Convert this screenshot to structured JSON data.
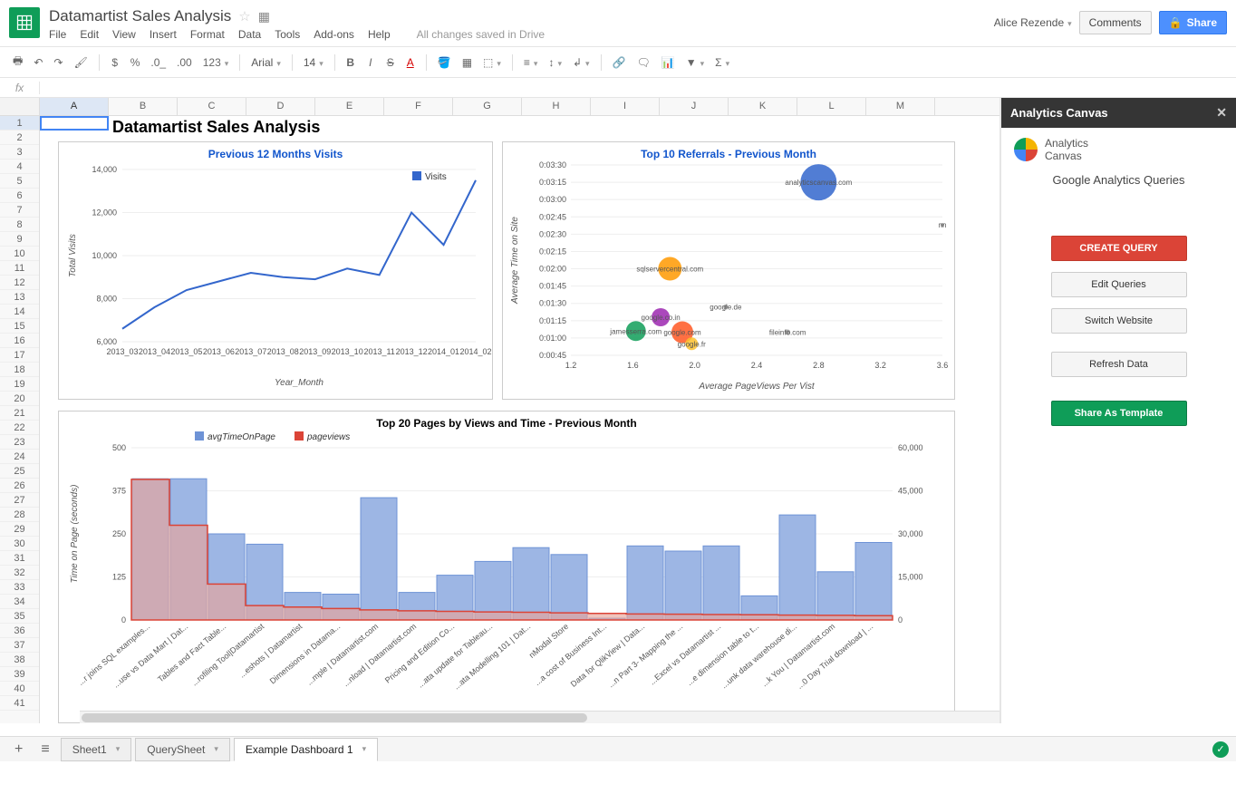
{
  "doc": {
    "title": "Datamartist Sales Analysis"
  },
  "user": {
    "name": "Alice Rezende"
  },
  "header": {
    "comments": "Comments",
    "share": "Share",
    "status": "All changes saved in Drive"
  },
  "menus": [
    "File",
    "Edit",
    "View",
    "Insert",
    "Format",
    "Data",
    "Tools",
    "Add-ons",
    "Help"
  ],
  "toolbar": {
    "font": "Arial",
    "size": "14",
    "numfmt": "123"
  },
  "formula": {
    "label": "fx",
    "value": ""
  },
  "columns": [
    "A",
    "B",
    "C",
    "D",
    "E",
    "F",
    "G",
    "H",
    "I",
    "J",
    "K",
    "L",
    "M"
  ],
  "dashboard": {
    "title": "Datamartist Sales Analysis"
  },
  "sidebar": {
    "title": "Analytics Canvas",
    "brand": "Analytics\nCanvas",
    "heading": "Google Analytics Queries",
    "create": "CREATE QUERY",
    "edit": "Edit Queries",
    "switch": "Switch Website",
    "refresh": "Refresh Data",
    "share": "Share As Template"
  },
  "tabs": {
    "sheet1": "Sheet1",
    "query": "QuerySheet",
    "dash": "Example Dashboard 1"
  },
  "chart_data": [
    {
      "id": "visits_line",
      "type": "line",
      "title": "Previous 12 Months Visits",
      "xlabel": "Year_Month",
      "ylabel": "Total Visits",
      "series": [
        {
          "name": "Visits",
          "color": "#3366cc"
        }
      ],
      "categories": [
        "2013_03",
        "2013_04",
        "2013_05",
        "2013_06",
        "2013_07",
        "2013_08",
        "2013_09",
        "2013_10",
        "2013_11",
        "2013_12",
        "2014_01",
        "2014_02"
      ],
      "values": [
        6600,
        7600,
        8400,
        8800,
        9200,
        9000,
        8900,
        9400,
        9100,
        12000,
        10500,
        13500
      ],
      "ylim": [
        6000,
        14000
      ],
      "yticks": [
        6000,
        8000,
        10000,
        12000,
        14000
      ]
    },
    {
      "id": "referrals_bubble",
      "type": "scatter",
      "title": "Top 10 Referrals - Previous Month",
      "xlabel": "Average PageViews Per Vist",
      "ylabel": "Average Time on Site",
      "xlim": [
        1.2,
        3.6
      ],
      "xticks": [
        1.2,
        1.6,
        2.0,
        2.4,
        2.8,
        3.2,
        3.6
      ],
      "yticks": [
        "0:00:45",
        "0:01:00",
        "0:01:15",
        "0:01:30",
        "0:01:45",
        "0:02:00",
        "0:02:15",
        "0:02:30",
        "0:02:45",
        "0:03:00",
        "0:03:15",
        "0:03:30"
      ],
      "points": [
        {
          "label": "analyticscanvas.com",
          "x": 2.8,
          "y": "0:03:15",
          "size": 40,
          "color": "#3366cc"
        },
        {
          "label": "sqlservercentral.com",
          "x": 1.84,
          "y": "0:02:00",
          "size": 26,
          "color": "#ff9900"
        },
        {
          "label": "google.de",
          "x": 2.2,
          "y": "0:01:27",
          "size": 5,
          "color": "#999"
        },
        {
          "label": "google.co.in",
          "x": 1.78,
          "y": "0:01:18",
          "size": 20,
          "color": "#9c27b0"
        },
        {
          "label": "jamesserra.com",
          "x": 1.62,
          "y": "0:01:06",
          "size": 22,
          "color": "#0f9d58"
        },
        {
          "label": "google.com",
          "x": 1.92,
          "y": "0:01:05",
          "size": 24,
          "color": "#ff5722"
        },
        {
          "label": "fileinfo.com",
          "x": 2.6,
          "y": "0:01:05",
          "size": 6,
          "color": "#999"
        },
        {
          "label": "google.fr",
          "x": 1.98,
          "y": "0:00:55",
          "size": 14,
          "color": "#fbc02d"
        },
        {
          "label": "nn",
          "x": 3.6,
          "y": "0:02:38",
          "size": 4,
          "color": "#999"
        }
      ]
    },
    {
      "id": "pages_combo",
      "type": "bar",
      "title": "Top 20 Pages by Views and Time - Previous Month",
      "y_left_label": "Time on Page (seconds)",
      "y_left_lim": [
        0,
        500
      ],
      "y_left_ticks": [
        0,
        125,
        250,
        375,
        500
      ],
      "y_right_lim": [
        0,
        60000
      ],
      "y_right_ticks": [
        0,
        15000,
        30000,
        45000,
        60000
      ],
      "series": [
        {
          "name": "avgTimeOnPage",
          "color": "#6e93d6",
          "axis": "left"
        },
        {
          "name": "pageviews",
          "color": "#db4437",
          "axis": "right"
        }
      ],
      "categories": [
        "...r joins SQL examples...",
        "...use vs Data Mart | Dat...",
        "Tables and Fact Table...",
        "...rofiling Tool|Datamartist",
        "...eshots | Datamartist",
        "Dimensions in Datama...",
        "...mple | Datamartist.com",
        "...nload | Datamartist.com",
        "Pricing and Edition Co...",
        "...ata update for Tableau...",
        "...ata Modelling 101 | Dat...",
        "nModal Store",
        "...a cost of Business Int...",
        "Data for QlikView | Data...",
        "...n Part 3- Mapping the ...",
        "...Excel vs Datamartist ...",
        "...e dimension table to t...",
        "...unk data warehouse di...",
        "...k You | Datamartist.com",
        "...0 Day Trial download | ..."
      ],
      "avgTimeOnPage": [
        410,
        410,
        250,
        220,
        80,
        75,
        355,
        80,
        130,
        170,
        210,
        190,
        5,
        215,
        200,
        215,
        70,
        305,
        140,
        225
      ],
      "pageviews": [
        49000,
        33000,
        12500,
        5000,
        4500,
        4000,
        3500,
        3200,
        3000,
        2800,
        2700,
        2500,
        2300,
        2100,
        2000,
        1900,
        1800,
        1700,
        1600,
        1500
      ]
    }
  ]
}
